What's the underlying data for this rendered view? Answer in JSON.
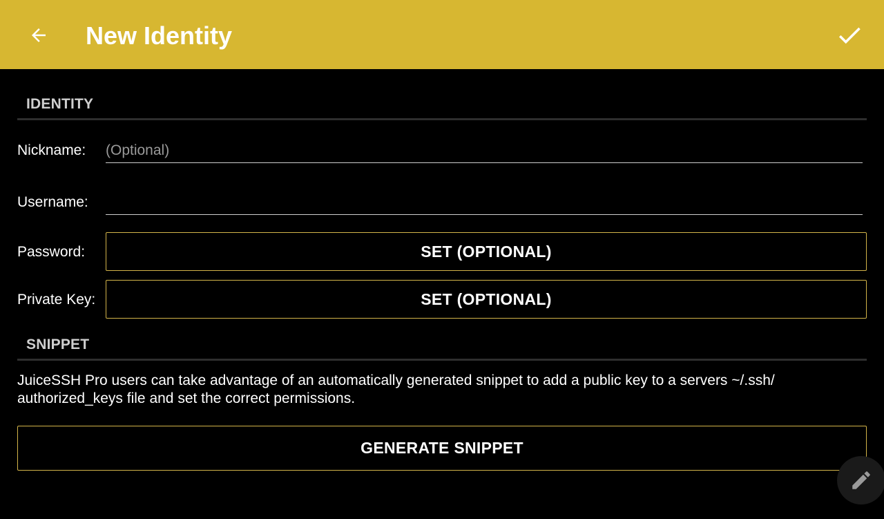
{
  "app_bar": {
    "title": "New Identity",
    "back_icon": "arrow-back-icon",
    "confirm_icon": "check-icon",
    "color": "#d7b731"
  },
  "identity_section": {
    "header": "IDENTITY",
    "nickname": {
      "label": "Nickname:",
      "value": "",
      "placeholder": "(Optional)"
    },
    "username": {
      "label": "Username:",
      "value": "",
      "placeholder": ""
    },
    "password": {
      "label": "Password:",
      "button_label": "SET (OPTIONAL)"
    },
    "private_key": {
      "label": "Private Key:",
      "button_label": "SET (OPTIONAL)"
    }
  },
  "snippet_section": {
    "header": "SNIPPET",
    "description": "JuiceSSH Pro users can take advantage of an automatically generated snippet to add a public key to a servers ~/.ssh/ authorized_keys file and set the correct permissions.",
    "generate_button_label": "GENERATE SNIPPET"
  },
  "fab": {
    "icon": "pencil-icon"
  },
  "colors": {
    "accent": "#d7b731",
    "button_border": "#d4b54a",
    "background": "#000000"
  }
}
